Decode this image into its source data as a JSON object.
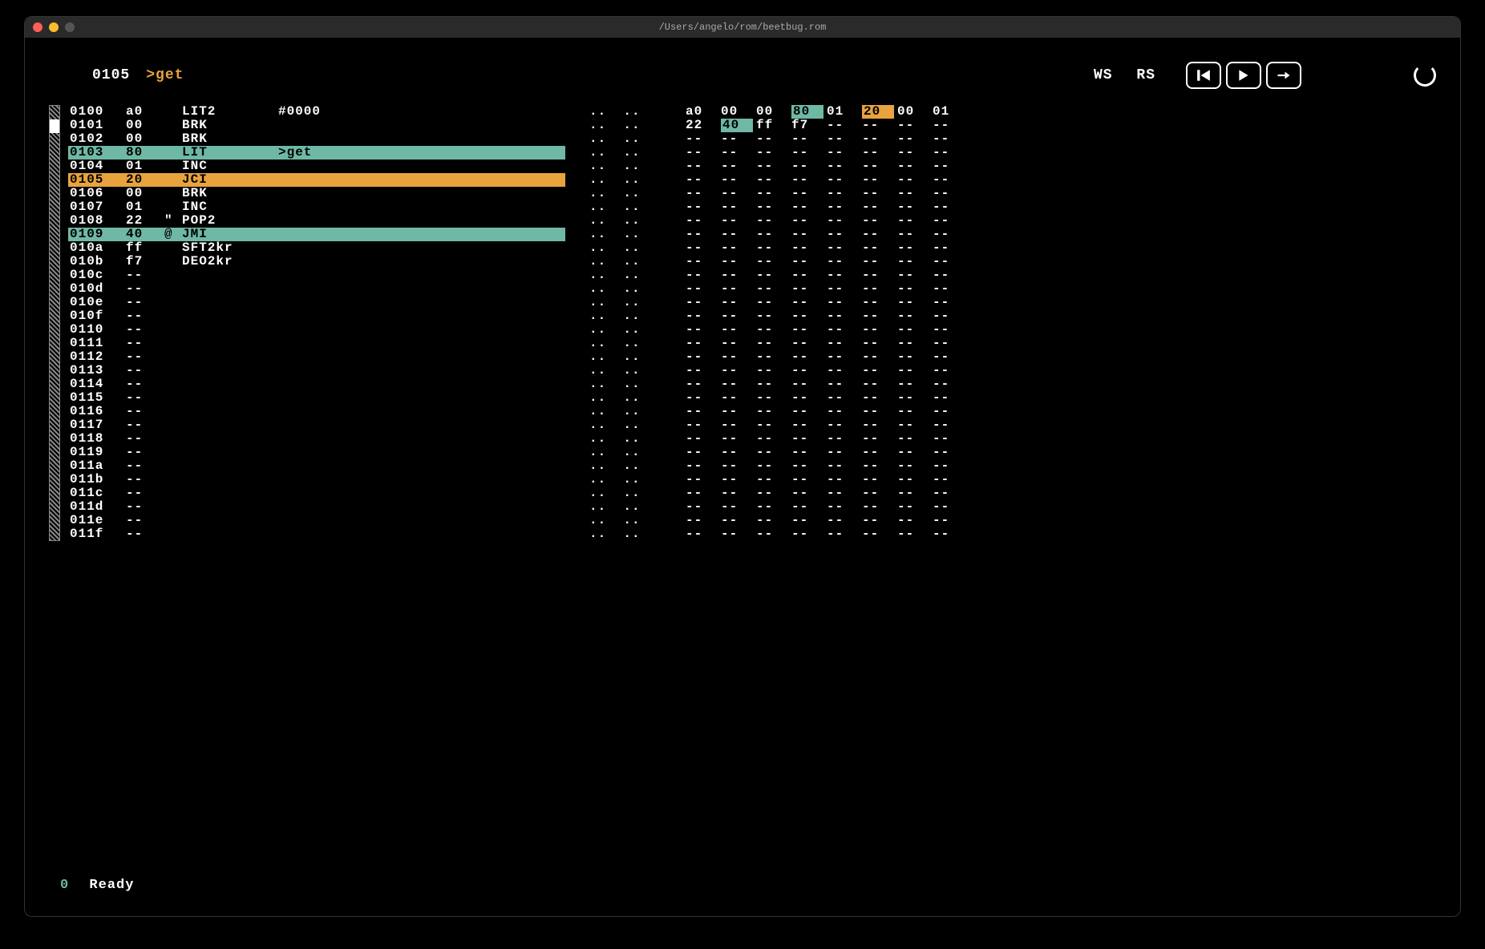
{
  "window": {
    "title": "/Users/angelo/rom/beetbug.rom"
  },
  "header": {
    "addr": "0105",
    "label": ">get",
    "ws": "WS",
    "rs": "RS"
  },
  "controls": {
    "rewind": "rewind",
    "play": "play",
    "step": "step"
  },
  "colors": {
    "teal": "#6fb8a5",
    "orange": "#e8a33d"
  },
  "disasm": [
    {
      "addr": "0100",
      "byte": "a0",
      "ch": "",
      "mnem": "LIT2",
      "oper": "#0000",
      "hl": "",
      "mark": false
    },
    {
      "addr": "0101",
      "byte": "00",
      "ch": "",
      "mnem": "BRK",
      "oper": "",
      "hl": "",
      "mark": true
    },
    {
      "addr": "0102",
      "byte": "00",
      "ch": "",
      "mnem": "BRK",
      "oper": "",
      "hl": "",
      "mark": false
    },
    {
      "addr": "0103",
      "byte": "80",
      "ch": "",
      "mnem": "LIT",
      "oper": ">get",
      "hl": "teal",
      "mark": false
    },
    {
      "addr": "0104",
      "byte": "01",
      "ch": "",
      "mnem": "INC",
      "oper": "",
      "hl": "",
      "mark": false
    },
    {
      "addr": "0105",
      "byte": "20",
      "ch": "",
      "mnem": "JCI",
      "oper": "",
      "hl": "orange",
      "mark": false
    },
    {
      "addr": "0106",
      "byte": "00",
      "ch": "",
      "mnem": "BRK",
      "oper": "",
      "hl": "",
      "mark": false
    },
    {
      "addr": "0107",
      "byte": "01",
      "ch": "",
      "mnem": "INC",
      "oper": "",
      "hl": "",
      "mark": false
    },
    {
      "addr": "0108",
      "byte": "22",
      "ch": "\"",
      "mnem": "POP2",
      "oper": "",
      "hl": "",
      "mark": false
    },
    {
      "addr": "0109",
      "byte": "40",
      "ch": "@",
      "mnem": "JMI",
      "oper": "",
      "hl": "teal",
      "mark": false
    },
    {
      "addr": "010a",
      "byte": "ff",
      "ch": "",
      "mnem": "SFT2kr",
      "oper": "",
      "hl": "",
      "mark": false
    },
    {
      "addr": "010b",
      "byte": "f7",
      "ch": "",
      "mnem": "DEO2kr",
      "oper": "",
      "hl": "",
      "mark": false
    },
    {
      "addr": "010c",
      "byte": "--",
      "ch": "",
      "mnem": "",
      "oper": "",
      "hl": "",
      "mark": false
    },
    {
      "addr": "010d",
      "byte": "--",
      "ch": "",
      "mnem": "",
      "oper": "",
      "hl": "",
      "mark": false
    },
    {
      "addr": "010e",
      "byte": "--",
      "ch": "",
      "mnem": "",
      "oper": "",
      "hl": "",
      "mark": false
    },
    {
      "addr": "010f",
      "byte": "--",
      "ch": "",
      "mnem": "",
      "oper": "",
      "hl": "",
      "mark": false
    },
    {
      "addr": "0110",
      "byte": "--",
      "ch": "",
      "mnem": "",
      "oper": "",
      "hl": "",
      "mark": false
    },
    {
      "addr": "0111",
      "byte": "--",
      "ch": "",
      "mnem": "",
      "oper": "",
      "hl": "",
      "mark": false
    },
    {
      "addr": "0112",
      "byte": "--",
      "ch": "",
      "mnem": "",
      "oper": "",
      "hl": "",
      "mark": false
    },
    {
      "addr": "0113",
      "byte": "--",
      "ch": "",
      "mnem": "",
      "oper": "",
      "hl": "",
      "mark": false
    },
    {
      "addr": "0114",
      "byte": "--",
      "ch": "",
      "mnem": "",
      "oper": "",
      "hl": "",
      "mark": false
    },
    {
      "addr": "0115",
      "byte": "--",
      "ch": "",
      "mnem": "",
      "oper": "",
      "hl": "",
      "mark": false
    },
    {
      "addr": "0116",
      "byte": "--",
      "ch": "",
      "mnem": "",
      "oper": "",
      "hl": "",
      "mark": false
    },
    {
      "addr": "0117",
      "byte": "--",
      "ch": "",
      "mnem": "",
      "oper": "",
      "hl": "",
      "mark": false
    },
    {
      "addr": "0118",
      "byte": "--",
      "ch": "",
      "mnem": "",
      "oper": "",
      "hl": "",
      "mark": false
    },
    {
      "addr": "0119",
      "byte": "--",
      "ch": "",
      "mnem": "",
      "oper": "",
      "hl": "",
      "mark": false
    },
    {
      "addr": "011a",
      "byte": "--",
      "ch": "",
      "mnem": "",
      "oper": "",
      "hl": "",
      "mark": false
    },
    {
      "addr": "011b",
      "byte": "--",
      "ch": "",
      "mnem": "",
      "oper": "",
      "hl": "",
      "mark": false
    },
    {
      "addr": "011c",
      "byte": "--",
      "ch": "",
      "mnem": "",
      "oper": "",
      "hl": "",
      "mark": false
    },
    {
      "addr": "011d",
      "byte": "--",
      "ch": "",
      "mnem": "",
      "oper": "",
      "hl": "",
      "mark": false
    },
    {
      "addr": "011e",
      "byte": "--",
      "ch": "",
      "mnem": "",
      "oper": "",
      "hl": "",
      "mark": false
    },
    {
      "addr": "011f",
      "byte": "--",
      "ch": "",
      "mnem": "",
      "oper": "",
      "hl": "",
      "mark": false
    }
  ],
  "dots_pair": "..  ..",
  "memory": [
    [
      {
        "v": "a0",
        "hl": ""
      },
      {
        "v": "00",
        "hl": ""
      },
      {
        "v": "00",
        "hl": ""
      },
      {
        "v": "80",
        "hl": "teal"
      },
      {
        "v": "01",
        "hl": ""
      },
      {
        "v": "20",
        "hl": "orange"
      },
      {
        "v": "00",
        "hl": ""
      },
      {
        "v": "01",
        "hl": ""
      }
    ],
    [
      {
        "v": "22",
        "hl": ""
      },
      {
        "v": "40",
        "hl": "teal"
      },
      {
        "v": "ff",
        "hl": ""
      },
      {
        "v": "f7",
        "hl": ""
      },
      {
        "v": "--",
        "hl": ""
      },
      {
        "v": "--",
        "hl": ""
      },
      {
        "v": "--",
        "hl": ""
      },
      {
        "v": "--",
        "hl": ""
      }
    ]
  ],
  "memory_blank_rows": 30,
  "status": {
    "n": "0",
    "text": "Ready"
  }
}
